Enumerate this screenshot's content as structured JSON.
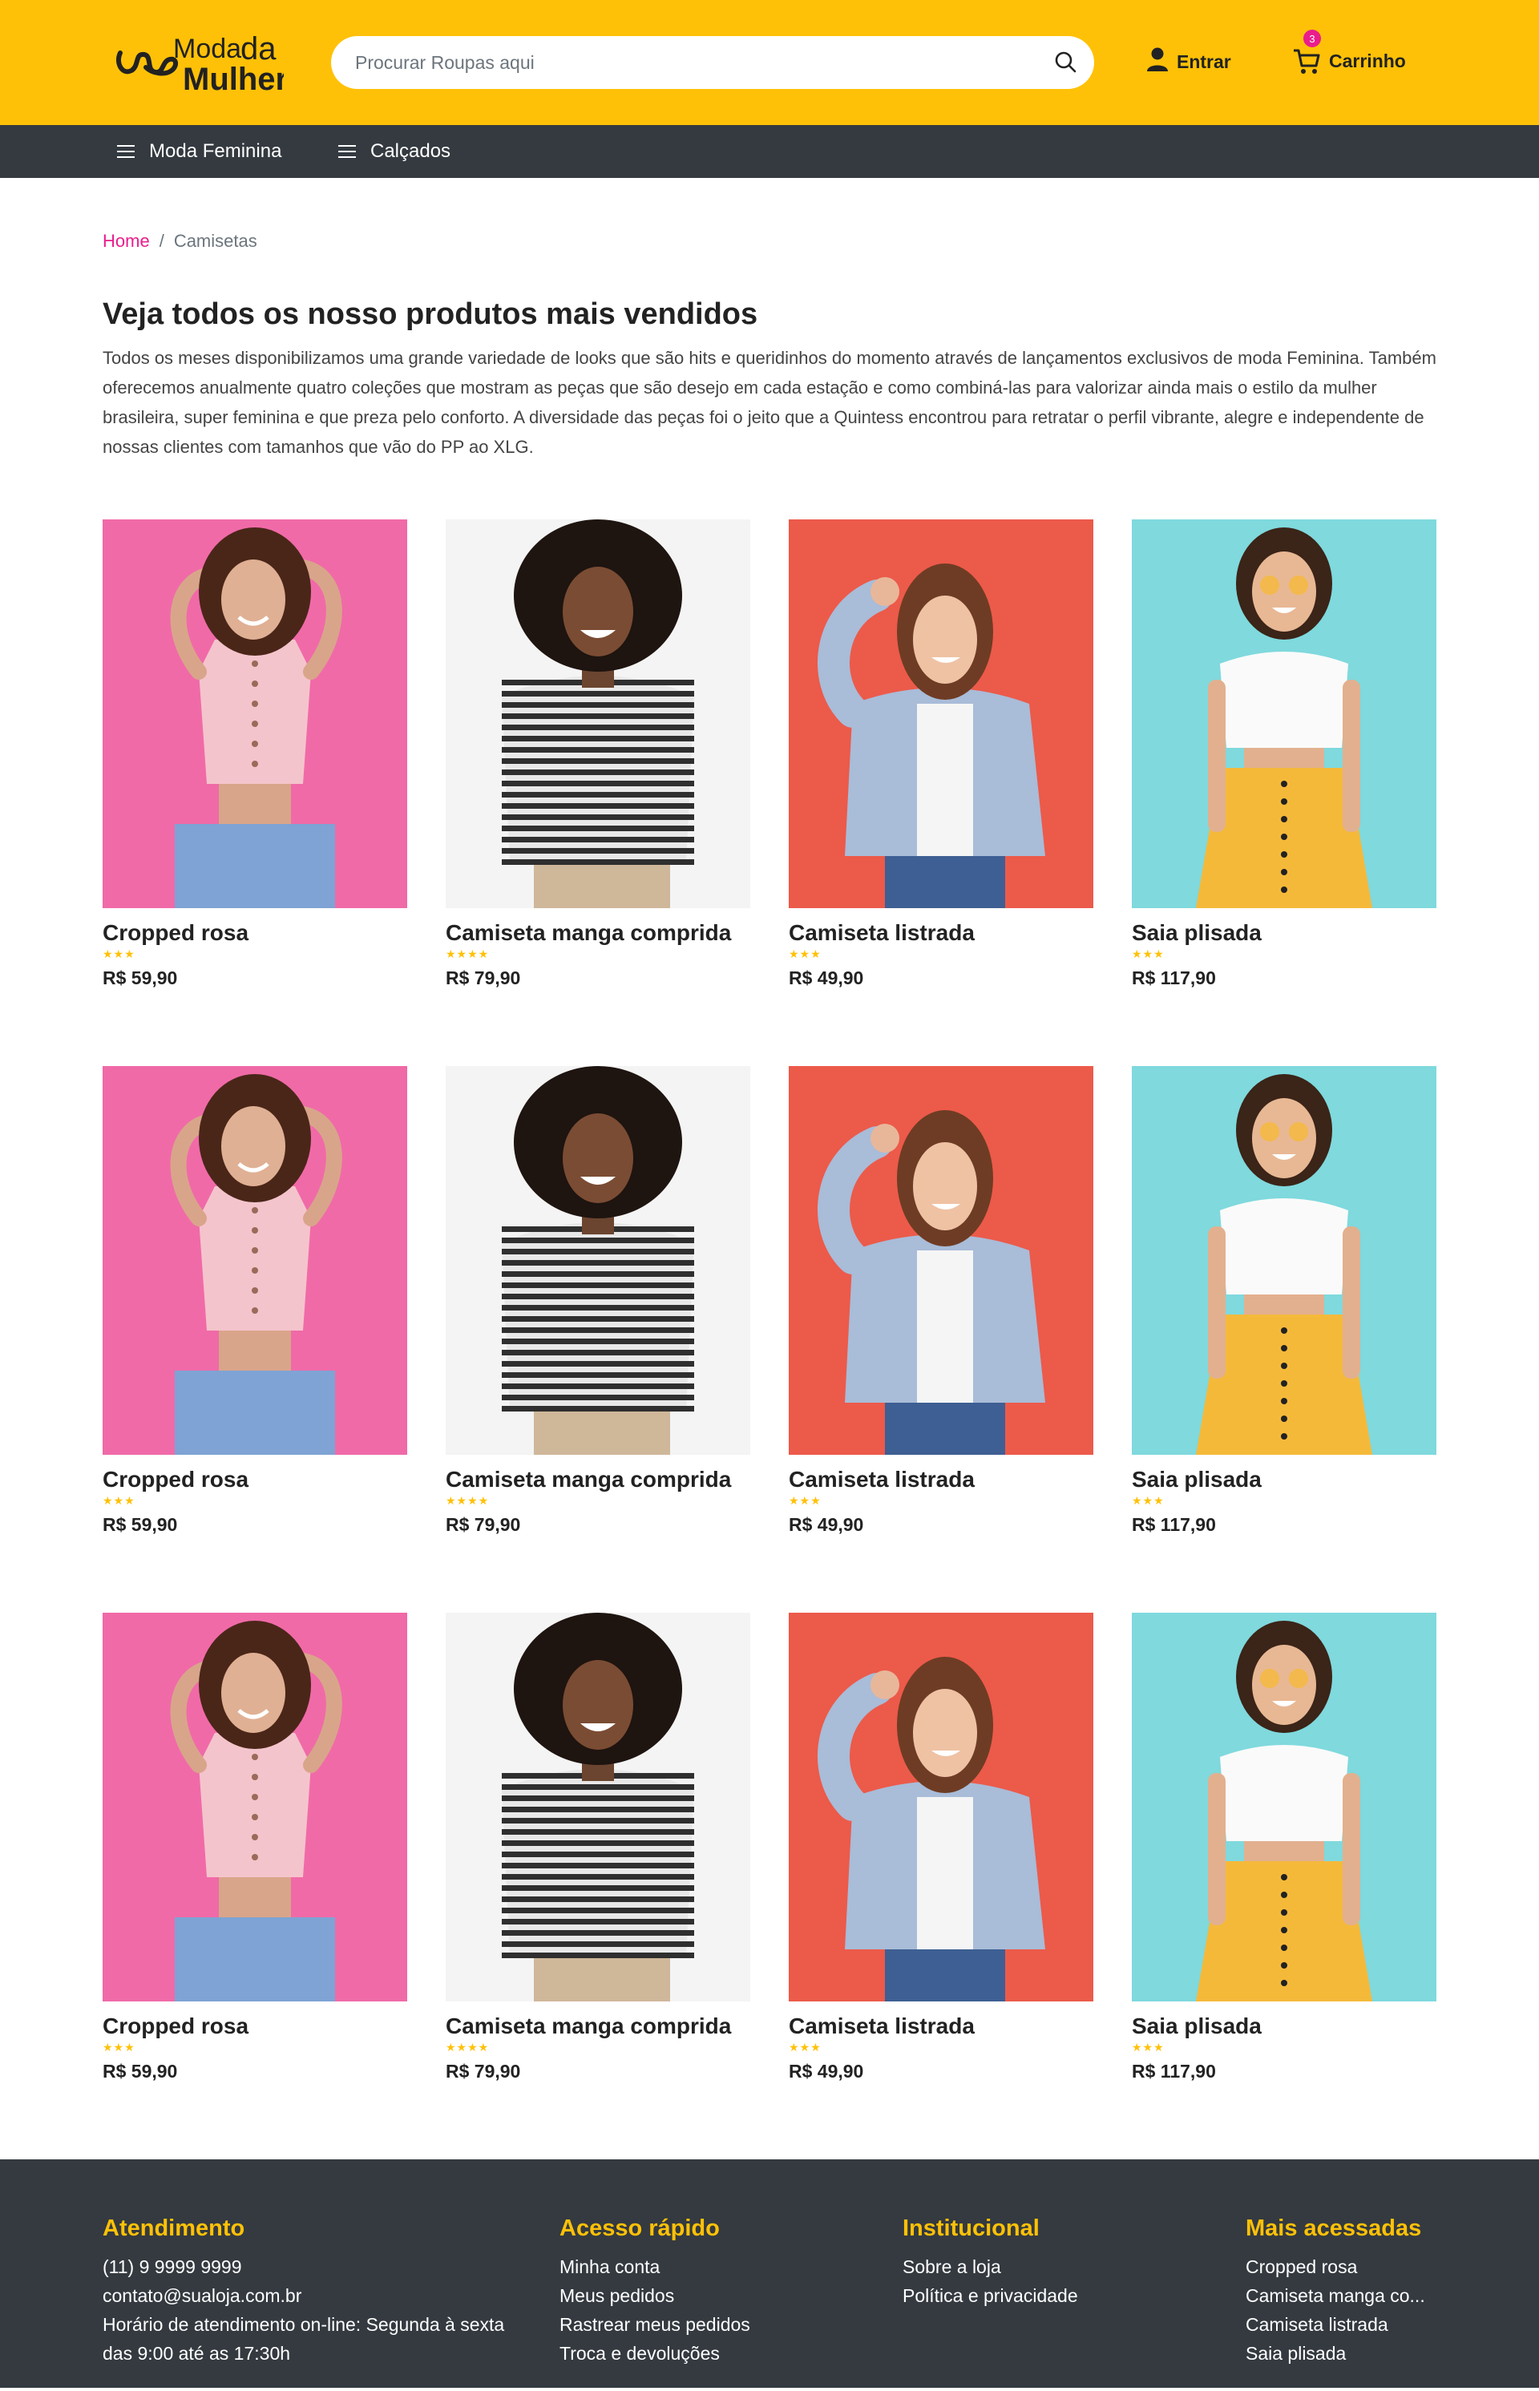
{
  "header": {
    "logo_line1": "Moda",
    "logo_line2": "da",
    "logo_line3": "Mulher",
    "search_placeholder": "Procurar Roupas aqui",
    "login_label": "Entrar",
    "cart_label": "Carrinho",
    "cart_count": "3"
  },
  "nav": {
    "items": [
      {
        "label": "Moda Feminina"
      },
      {
        "label": "Calçados"
      }
    ]
  },
  "breadcrumb": {
    "home": "Home",
    "separator": "/",
    "current": "Camisetas"
  },
  "page": {
    "title": "Veja todos os nosso produtos mais vendidos",
    "intro": "Todos os meses disponibilizamos uma grande variedade de looks que são hits e queridinhos do momento através de lançamentos exclusivos de moda Feminina. Também oferecemos anualmente quatro coleções que mostram as peças que são desejo em cada estação e como combiná-las para valorizar ainda mais o estilo da mulher brasileira, super feminina e que preza pelo conforto. A diversidade das peças foi o jeito que a Quintess encontrou para retratar o perfil vibrante, alegre e independente de nossas clientes com tamanhos que vão do PP ao XLG."
  },
  "products": [
    {
      "name": "Cropped rosa",
      "stars": "★★★",
      "price": "R$ 59,90",
      "image": "woman-pink-top"
    },
    {
      "name": "Camiseta manga comprida",
      "stars": "★★★★",
      "price": "R$ 79,90",
      "image": "woman-striped-shirt"
    },
    {
      "name": "Camiseta listrada",
      "stars": "★★★",
      "price": "R$ 49,90",
      "image": "woman-denim-shirt"
    },
    {
      "name": "Saia plisada",
      "stars": "★★★",
      "price": "R$ 117,90",
      "image": "woman-yellow-skirt"
    },
    {
      "name": "Cropped rosa",
      "stars": "★★★",
      "price": "R$ 59,90",
      "image": "woman-pink-top"
    },
    {
      "name": "Camiseta manga comprida",
      "stars": "★★★★",
      "price": "R$ 79,90",
      "image": "woman-striped-shirt"
    },
    {
      "name": "Camiseta listrada",
      "stars": "★★★",
      "price": "R$ 49,90",
      "image": "woman-denim-shirt"
    },
    {
      "name": "Saia plisada",
      "stars": "★★★",
      "price": "R$ 117,90",
      "image": "woman-yellow-skirt"
    },
    {
      "name": "Cropped rosa",
      "stars": "★★★",
      "price": "R$ 59,90",
      "image": "woman-pink-top"
    },
    {
      "name": "Camiseta manga comprida",
      "stars": "★★★★",
      "price": "R$ 79,90",
      "image": "woman-striped-shirt"
    },
    {
      "name": "Camiseta listrada",
      "stars": "★★★",
      "price": "R$ 49,90",
      "image": "woman-denim-shirt"
    },
    {
      "name": "Saia plisada",
      "stars": "★★★",
      "price": "R$ 117,90",
      "image": "woman-yellow-skirt"
    }
  ],
  "footer": {
    "atendimento": {
      "title": "Atendimento",
      "items": [
        "(11) 9 9999 9999",
        "contato@sualoja.com.br",
        "Horário de atendimento on-line: Segunda à sexta das 9:00 até as 17:30h"
      ]
    },
    "acesso": {
      "title": "Acesso rápido",
      "items": [
        "Minha conta",
        "Meus pedidos",
        "Rastrear meus pedidos",
        "Troca e devoluções"
      ]
    },
    "institucional": {
      "title": "Institucional",
      "items": [
        "Sobre a loja",
        "Política e privacidade"
      ]
    },
    "mais": {
      "title": "Mais acessadas",
      "items": [
        "Cropped rosa",
        "Camiseta manga co...",
        "Camiseta listrada",
        "Saia plisada"
      ]
    }
  },
  "colors": {
    "brand_yellow": "#ffc107",
    "dark": "#343a40",
    "accent_pink": "#e91e8c"
  }
}
